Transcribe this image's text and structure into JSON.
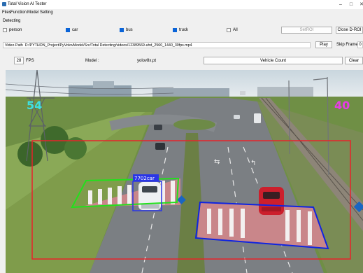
{
  "window": {
    "title": "Total Vision AI Tester",
    "controls": [
      "–",
      "□",
      "✕"
    ]
  },
  "menu": [
    "Files",
    "Function",
    "Model",
    "Setting"
  ],
  "detect_group": {
    "label": "Detecting"
  },
  "classes": [
    {
      "label": "person",
      "checked": false
    },
    {
      "label": "car",
      "checked": true
    },
    {
      "label": "bus",
      "checked": true
    },
    {
      "label": "truck",
      "checked": true
    },
    {
      "label": "All",
      "checked": false
    }
  ],
  "buttons": {
    "set_roi": "SetROI",
    "close_droi": "Close D-ROI",
    "play": "Play",
    "vehicle_count": "Vehicle Count",
    "clear": "Clear"
  },
  "video_path": {
    "label": "Video Path",
    "value": "D:/PYTHON_Project/PyVolovModel/Src/Total Detecting/videos/12389569-uhd_2560_1440_30fps.mp4"
  },
  "skip_frame": {
    "label": "Skip Frame",
    "value": "0"
  },
  "fps": {
    "value": "28",
    "label": "FPS"
  },
  "model": {
    "label": "Model :",
    "name": "yolov8x.pt"
  },
  "overlay": {
    "count_left": "54",
    "count_right": "40",
    "detection_label": "7702car",
    "colors": {
      "roi": "#e8232b",
      "zone_left": "#22e01c",
      "zone_right": "#1024e0",
      "box": "#2a36e6",
      "count_left": "#3fe0e0",
      "count_right": "#e83ae8"
    }
  }
}
